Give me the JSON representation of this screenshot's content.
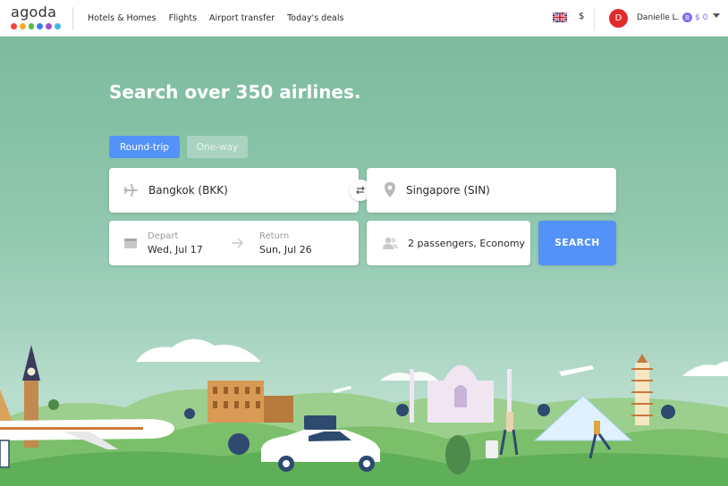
{
  "header": {
    "logo_text": "agoda",
    "logo_colors": [
      "#f0433b",
      "#f7a928",
      "#53b848",
      "#3a7ee8",
      "#9b4dcb",
      "#42b5e8"
    ],
    "nav": [
      "Hotels & Homes",
      "Flights",
      "Airport transfer",
      "Today's deals"
    ],
    "currency": "$",
    "avatar_initial": "D",
    "username": "Danielle L.",
    "points_icon": "B",
    "points": "$ 0"
  },
  "hero": {
    "headline": "Search over 350 airlines.",
    "tabs": {
      "round_trip": "Round-trip",
      "one_way": "One-way"
    },
    "from": "Bangkok (BKK)",
    "to": "Singapore (SIN)",
    "depart_label": "Depart",
    "depart_value": "Wed, Jul 17",
    "return_label": "Return",
    "return_value": "Sun, Jul 26",
    "passengers": "2 passengers, Economy",
    "search_label": "SEARCH"
  },
  "colors": {
    "accent": "#5392f9",
    "avatar": "#e12b2b",
    "points": "#7a6ef0"
  },
  "icons": [
    "plane-icon",
    "swap-icon",
    "location-pin-icon",
    "calendar-icon",
    "arrow-right-icon",
    "people-icon",
    "flag-uk-icon",
    "chevron-down-icon"
  ]
}
